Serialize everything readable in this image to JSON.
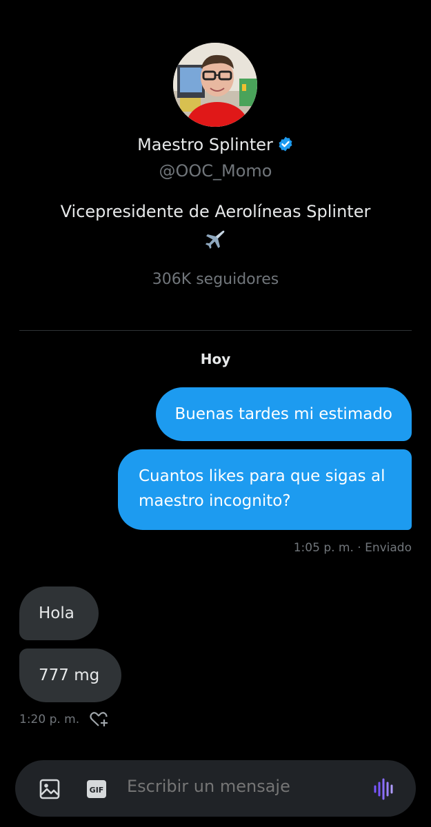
{
  "profile": {
    "name": "Maestro Splinter",
    "handle": "@OOC_Momo",
    "bio": "Vicepresidente de Aerolíneas Splinter",
    "followers": "306K seguidores",
    "verified": true,
    "verified_color": "#1d9bf0"
  },
  "conversation": {
    "date_separator": "Hoy",
    "outgoing": [
      {
        "text": "Buenas tardes mi estimado"
      },
      {
        "text": "Cuantos likes para que sigas al maestro incognito?"
      }
    ],
    "outgoing_meta": "1:05 p. m. · Enviado",
    "incoming": [
      {
        "text": "Hola"
      },
      {
        "text": "777 mg"
      }
    ],
    "incoming_meta": "1:20 p. m."
  },
  "composer": {
    "placeholder": "Escribir un mensaje",
    "icons": [
      "image-icon",
      "gif-icon",
      "voice-message-icon"
    ],
    "voice_color": "#7856ff"
  },
  "colors": {
    "background": "#000000",
    "outgoing_bubble": "#1d9bf0",
    "incoming_bubble": "#2f3336",
    "secondary_text": "#71767b"
  }
}
